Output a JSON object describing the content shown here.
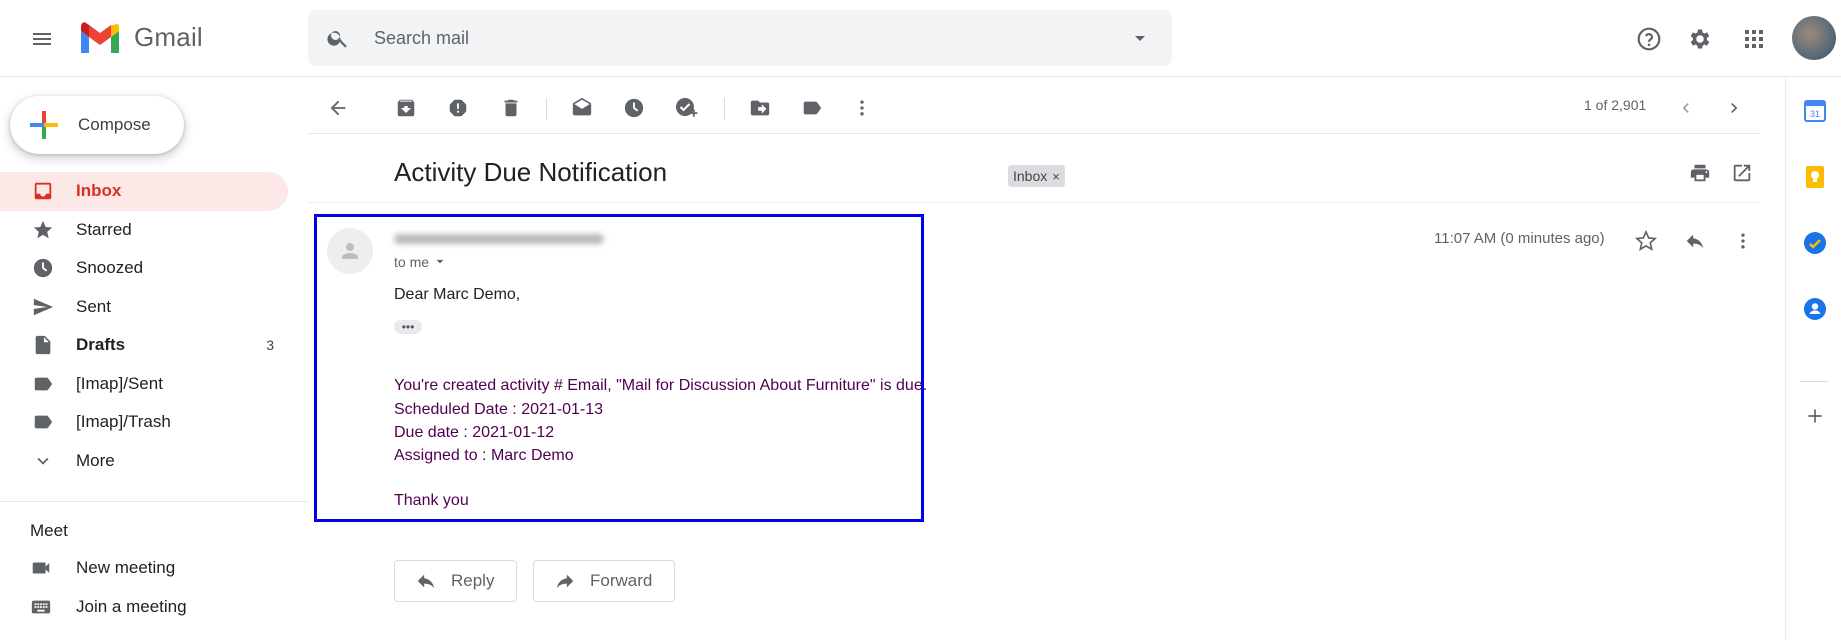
{
  "app": {
    "name": "Gmail"
  },
  "header": {
    "search_placeholder": "Search mail",
    "icons": [
      "menu-icon",
      "gmail-logo-icon",
      "search-icon",
      "search-options-icon",
      "help-icon",
      "settings-icon",
      "apps-icon",
      "account-avatar"
    ]
  },
  "sidebar": {
    "compose_label": "Compose",
    "items": [
      {
        "label": "Inbox",
        "icon": "inbox-icon",
        "active": true,
        "count": ""
      },
      {
        "label": "Starred",
        "icon": "star-icon",
        "count": ""
      },
      {
        "label": "Snoozed",
        "icon": "clock-icon",
        "count": ""
      },
      {
        "label": "Sent",
        "icon": "send-icon",
        "count": ""
      },
      {
        "label": "Drafts",
        "icon": "draft-icon",
        "count": "3"
      },
      {
        "label": "[Imap]/Sent",
        "icon": "label-icon",
        "count": ""
      },
      {
        "label": "[Imap]/Trash",
        "icon": "label-icon",
        "count": ""
      },
      {
        "label": "More",
        "icon": "chevron-down-icon",
        "count": ""
      }
    ],
    "meet": {
      "title": "Meet",
      "new_meeting": "New meeting",
      "join_meeting": "Join a meeting"
    }
  },
  "toolbar": {
    "pager": "1 of 2,901"
  },
  "message": {
    "subject": "Activity Due Notification",
    "label_chip": "Inbox",
    "label_chip_close": "×",
    "to_me": "to me",
    "timestamp": "11:07 AM (0 minutes ago)",
    "greeting": "Dear Marc Demo,",
    "ellipsis": "•••",
    "lines": [
      "You're created activity # Email, \"Mail for Discussion About Furniture\" is due.",
      "Scheduled Date : 2021-01-13",
      "Due date : 2021-01-12",
      "Assigned to : Marc Demo",
      "Thank you"
    ],
    "reply_label": "Reply",
    "forward_label": "Forward"
  },
  "colors": {
    "active_nav_bg": "#fce8e6",
    "active_nav_text": "#d93025",
    "highlight_border": "#0000e6",
    "body_purple": "#500050"
  }
}
